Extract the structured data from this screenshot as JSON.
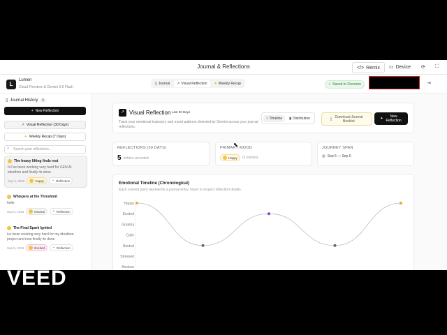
{
  "window": {
    "title": "Journal & Reflections",
    "remix_label": "Remix",
    "device_label": "Device"
  },
  "app": {
    "name": "Lumen",
    "subtitle": "Cloud Firestore & Gemini 3.6 Flash",
    "logo_letter": "L",
    "tabs": [
      {
        "label": "Journal",
        "icon": "book-icon"
      },
      {
        "label": "Visual Reflection",
        "icon": "trend-icon"
      },
      {
        "label": "Weekly Recap",
        "icon": "sparkle-icon"
      }
    ],
    "saved_label": "Saved to Firestore"
  },
  "sidebar": {
    "heading": "Journal History",
    "count": "5",
    "new_button": "New Reflection",
    "visual_button": "Visual Reflection (30 Days)",
    "weekly_button": "Weekly Recap (7 Days)",
    "search_placeholder": "Search past reflections...",
    "entries": [
      {
        "title": "The heavy lifting finds rest",
        "body": "hi I've been working very hard for GEN AI ideathon and finally its done",
        "date": "Sep 6, 2026",
        "mood": "Happy",
        "tag": "Reflection"
      },
      {
        "title": "Whispers at the Threshold",
        "body": "hello",
        "date": "Sep 6, 2026",
        "mood": "Neutral",
        "tag": "Reflection"
      },
      {
        "title": "The Final Spark Ignited",
        "body": "ive been working very hard for my ideathon project and now finally its done",
        "date": "Sep 5, 2026",
        "mood": "Excited",
        "tag": "Reflection"
      }
    ]
  },
  "main": {
    "title": "Visual Reflection",
    "badge": "Last 30 Days",
    "description": "Track your emotional trajectory and mood patterns detected by Gemini across your journal reflections.",
    "toggle": {
      "timeline": "Timeline",
      "distribution": "Distribution"
    },
    "download_label": "Download Journal Booklet",
    "new_label": "New Reflection",
    "stats": [
      {
        "label": "REFLECTIONS (30 DAYS)",
        "value": "5",
        "note": "entries recorded"
      },
      {
        "label": "PRIMARY MOOD",
        "value": "Happy",
        "note": "(2 entries)"
      },
      {
        "label": "JOURNEY SPAN",
        "value": "Sep 5 — Sep 6",
        "note": ""
      }
    ]
  },
  "colors": {
    "happy": "#e0b030",
    "neutral": "#666666",
    "excited": "#8a44c8",
    "line": "#bdbdbd"
  },
  "chart_data": {
    "type": "line",
    "title": "Emotional Timeline (Chronological)",
    "subtitle": "Each colored point represents a journal entry, hover to inspect reflection details.",
    "y_categories": [
      "Happy",
      "Excited",
      "Grateful",
      "Calm",
      "Neutral",
      "Stressed",
      "Anxious"
    ],
    "points": [
      {
        "index": 1,
        "mood": "Happy"
      },
      {
        "index": 2,
        "mood": "Neutral"
      },
      {
        "index": 3,
        "mood": "Excited"
      },
      {
        "index": 4,
        "mood": "Neutral"
      },
      {
        "index": 5,
        "mood": "Happy"
      }
    ],
    "grid": false
  }
}
